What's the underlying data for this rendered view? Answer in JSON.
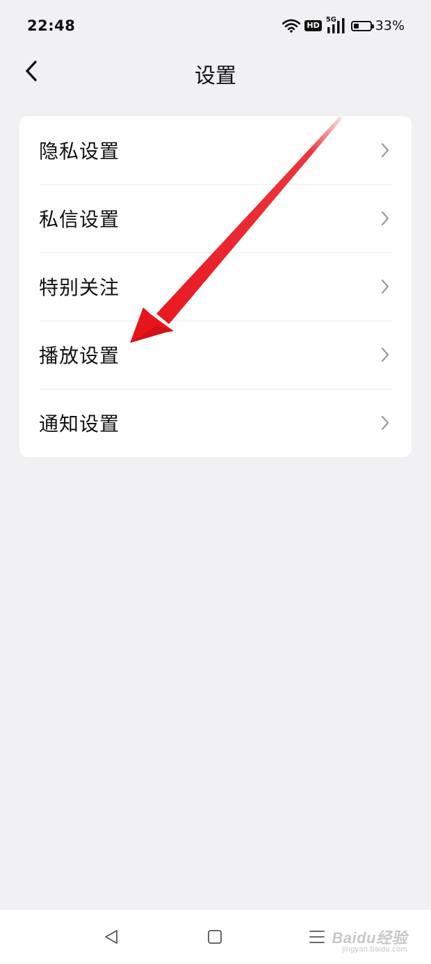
{
  "status_bar": {
    "time": "22:48",
    "network_label": "5G",
    "hd_label": "HD",
    "battery_percent": "33%",
    "battery_level": 0.33,
    "icons": [
      "wifi-icon",
      "hd-icon",
      "signal-icon",
      "battery-icon"
    ]
  },
  "header": {
    "title": "设置",
    "back_icon": "chevron-left-icon"
  },
  "settings_list": {
    "items": [
      {
        "label": "隐私设置"
      },
      {
        "label": "私信设置"
      },
      {
        "label": "特别关注"
      },
      {
        "label": "播放设置"
      },
      {
        "label": "通知设置"
      }
    ]
  },
  "annotation": {
    "color": "#e8141c",
    "target": "播放设置"
  },
  "nav_bar": {
    "icons": [
      "triangle-back-icon",
      "square-home-icon",
      "menu-lines-icon"
    ]
  },
  "watermark": {
    "brand": "Baidu经验",
    "url": "jingyan.baidu.com"
  },
  "colors": {
    "background": "#f1f1f4",
    "card": "#ffffff",
    "text": "#111111",
    "chevron": "#9a9a9a",
    "divider": "#ececec"
  }
}
